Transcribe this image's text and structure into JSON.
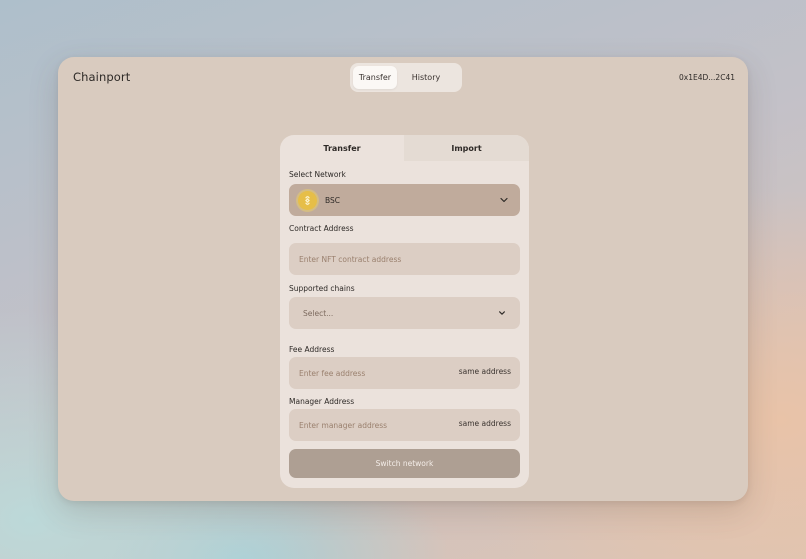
{
  "app": {
    "brand": "Chainport",
    "wallet": "0x1E4D...2C41"
  },
  "nav": {
    "tabs": [
      "Transfer",
      "History"
    ],
    "active": "Transfer"
  },
  "card": {
    "tabs": [
      "Transfer",
      "Import"
    ],
    "network": {
      "label": "Select Network",
      "value": "BSC",
      "icon": "bnb-coin-icon"
    },
    "contract": {
      "label": "Contract Address",
      "placeholder": "Enter NFT contract address"
    },
    "chains": {
      "label": "Supported chains",
      "placeholder": "Select..."
    },
    "fee": {
      "label": "Fee Address",
      "placeholder": "Enter fee address",
      "action": "same address"
    },
    "manager": {
      "label": "Manager Address",
      "placeholder": "Enter manager address",
      "action": "same address"
    },
    "submit": "Switch network"
  },
  "colors": {
    "accent_network": "#c0ab9c",
    "coin": "#e6be48",
    "submit": "#ae9f93"
  }
}
